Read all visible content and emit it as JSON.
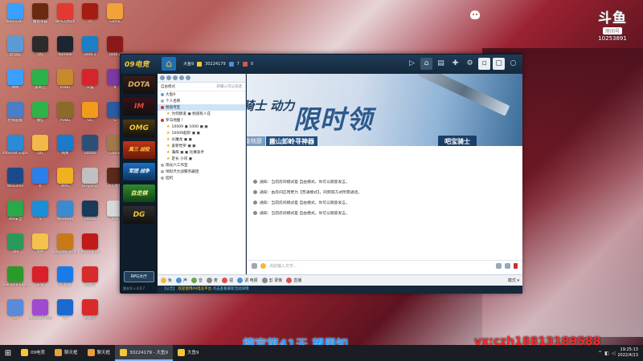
{
  "desktop": {
    "icons": [
      {
        "label": "Administ...",
        "color": "#3aa0ff",
        "col": 0,
        "row": 0
      },
      {
        "label": "魔兽争霸",
        "color": "#6a2a12",
        "col": 1,
        "row": 0
      },
      {
        "label": "WPS Office",
        "color": "#e23a32",
        "col": 2,
        "row": 0
      },
      {
        "label": "cf",
        "color": "#a41c12",
        "col": 3,
        "row": 0
      },
      {
        "label": "Game",
        "color": "#f2a23a",
        "col": 4,
        "row": 0
      },
      {
        "label": "此电脑",
        "color": "#5b9bd5",
        "col": 0,
        "row": 1
      },
      {
        "label": "QQ",
        "color": "#2b2b2b",
        "col": 1,
        "row": 1
      },
      {
        "label": "Rumble",
        "color": "#1a2530",
        "col": 2,
        "row": 1
      },
      {
        "label": "Dota 2",
        "color": "#1b7fc6",
        "col": 3,
        "row": 1
      },
      {
        "label": "Dota 2",
        "color": "#8a1a1a",
        "col": 4,
        "row": 1
      },
      {
        "label": "网络",
        "color": "#3aa0ff",
        "col": 0,
        "row": 2
      },
      {
        "label": "爱奇艺",
        "color": "#29b34a",
        "col": 1,
        "row": 2
      },
      {
        "label": "PUBG",
        "color": "#c78a2a",
        "col": 2,
        "row": 2
      },
      {
        "label": "天猫",
        "color": "#d6252a",
        "col": 3,
        "row": 2
      },
      {
        "label": "9",
        "color": "#7c3aa5",
        "col": 4,
        "row": 2
      },
      {
        "label": "控制面板",
        "color": "#4a7ec6",
        "col": 0,
        "row": 3
      },
      {
        "label": "微信",
        "color": "#2db34a",
        "col": 1,
        "row": 3
      },
      {
        "label": "PUBG",
        "color": "#8b6b2a",
        "col": 2,
        "row": 3
      },
      {
        "label": "GG",
        "color": "#f29a1a",
        "col": 3,
        "row": 3
      },
      {
        "label": "G",
        "color": "#2a5ba5",
        "col": 4,
        "row": 3
      },
      {
        "label": "Internet Explorer",
        "color": "#2a8bd8",
        "col": 0,
        "row": 4
      },
      {
        "label": "QQ",
        "color": "#f2b84a",
        "col": 1,
        "row": 4
      },
      {
        "label": "网易",
        "color": "#1a7acc",
        "col": 2,
        "row": 4
      },
      {
        "label": "Steam",
        "color": "#2a5078",
        "col": 3,
        "row": 4
      },
      {
        "label": "Game",
        "color": "#a27a4a",
        "col": 4,
        "row": 4
      },
      {
        "label": "WeGame",
        "color": "#1a4a8a",
        "col": 0,
        "row": 5
      },
      {
        "label": "K",
        "color": "#2b7fe8",
        "col": 1,
        "row": 5
      },
      {
        "label": "WPS",
        "color": "#f0b020",
        "col": 2,
        "row": 5
      },
      {
        "label": "Dropship",
        "color": "#c0c0c0",
        "col": 3,
        "row": 5
      },
      {
        "label": "人工智能",
        "color": "#5a2a1a",
        "col": 4,
        "row": 5
      },
      {
        "label": "360安全",
        "color": "#2aa84a",
        "col": 0,
        "row": 6
      },
      {
        "label": "S",
        "color": "#1a8fd8",
        "col": 1,
        "row": 6
      },
      {
        "label": "Windows",
        "color": "#3a8bd0",
        "col": 2,
        "row": 6
      },
      {
        "label": "Steam",
        "color": "#1a3a5a",
        "col": 3,
        "row": 6
      },
      {
        "label": "网易",
        "color": "#d8d8d8",
        "col": 4,
        "row": 6
      },
      {
        "label": "360",
        "color": "#2a9a5a",
        "col": 0,
        "row": 7
      },
      {
        "label": "文件",
        "color": "#f2c24a",
        "col": 1,
        "row": 7
      },
      {
        "label": "Counter-Strike",
        "color": "#c87a1a",
        "col": 2,
        "row": 7
      },
      {
        "label": "Among Us",
        "color": "#c21a1a",
        "col": 3,
        "row": 7
      },
      {
        "label": "GeForce Experience",
        "color": "#2a9a2a",
        "col": 0,
        "row": 8
      },
      {
        "label": "天猫",
        "color": "#d8202a",
        "col": 1,
        "row": 8
      },
      {
        "label": "PC管家",
        "color": "#1a7ae8",
        "col": 2,
        "row": 8
      },
      {
        "label": "网易云",
        "color": "#d82a2a",
        "col": 3,
        "row": 8
      },
      {
        "label": "Git",
        "color": "#5a8ad8",
        "col": 0,
        "row": 9
      },
      {
        "label": "Powered Party",
        "color": "#a04ad0",
        "col": 1,
        "row": 9
      },
      {
        "label": "PS",
        "color": "#1a6ad0",
        "col": 2,
        "row": 9
      },
      {
        "label": "网易云",
        "color": "#d82a2a",
        "col": 3,
        "row": 9
      }
    ]
  },
  "douyu": {
    "logo": "斗鱼",
    "room_label": "房间号",
    "room_number": "10253891"
  },
  "app": {
    "logo": "09电竞",
    "user_name": "大鱼9",
    "user_id": "30224179",
    "user_count": "7",
    "user_extra": "0",
    "top_tools": [
      {
        "name": "video-icon",
        "glyph": "▷",
        "active": false,
        "box": false
      },
      {
        "name": "home-tab-icon",
        "glyph": "⌂",
        "active": true,
        "box": false
      },
      {
        "name": "list-icon",
        "glyph": "▤",
        "active": false,
        "box": false
      },
      {
        "name": "gamepad-icon",
        "glyph": "✚",
        "active": false,
        "box": false
      },
      {
        "name": "settings-icon",
        "glyph": "⚙",
        "active": false,
        "box": false
      },
      {
        "name": "minimize-box-icon",
        "glyph": "▫",
        "active": false,
        "box": true
      },
      {
        "name": "window-box-icon",
        "glyph": "▢",
        "active": false,
        "box": true
      },
      {
        "name": "close-icon",
        "glyph": "○",
        "active": false,
        "box": false
      }
    ],
    "games": [
      {
        "label": "DOTA",
        "cls": "g-dota"
      },
      {
        "label": "IM",
        "cls": "g-im"
      },
      {
        "label": "OMG",
        "cls": "g-omg"
      },
      {
        "label": "真三 战役",
        "cls": "g-orange"
      },
      {
        "label": "军团 战争",
        "cls": "g-blue"
      },
      {
        "label": "自走棋",
        "cls": "g-green"
      },
      {
        "label": "DG",
        "cls": "g-dg"
      }
    ],
    "rpg_button": "RPG大厅",
    "version": "版本号 v 4.0.7",
    "channel": {
      "mode": "自由模式",
      "right_hint": "新输入可以说话",
      "rows": [
        {
          "text": "大鱼9",
          "level": 0,
          "sel": false,
          "icon": "dot",
          "color": "#5a9ed8"
        },
        {
          "text": "个人名称",
          "level": 0,
          "sel": false,
          "icon": "dot",
          "color": "#aaa"
        },
        {
          "text": "频道专区",
          "level": 0,
          "sel": true,
          "icon": "dot",
          "color": "#d2322a"
        },
        {
          "text": "为何频道 ▣ 频道有人在",
          "level": 1,
          "sel": false,
          "icon": "star",
          "color": "#222"
        },
        {
          "text": "罗马地图 !",
          "level": 0,
          "sel": false,
          "icon": "dot",
          "color": "#d2322a"
        },
        {
          "text": "10009 ▣ 1000 ▣ ▣",
          "level": 1,
          "sel": false,
          "icon": "star",
          "color": "#222"
        },
        {
          "text": "10009超轩 ▣ ▣",
          "level": 1,
          "sel": false,
          "icon": "star",
          "color": "#222"
        },
        {
          "text": "炎魔龙 ▣ ▣",
          "level": 1,
          "sel": false,
          "icon": "star",
          "color": "#222"
        },
        {
          "text": "爱新觉罗 ▣ ▣",
          "level": 1,
          "sel": false,
          "icon": "star",
          "color": "#222"
        },
        {
          "text": "满辉 ▣ ▣ 比赛高手",
          "level": 1,
          "sel": false,
          "icon": "star",
          "color": "#222"
        },
        {
          "text": "定长 小司 ▣",
          "level": 1,
          "sel": false,
          "icon": "star",
          "color": "#222"
        },
        {
          "text": "阳光六工作室",
          "level": 0,
          "sel": false,
          "icon": "dot",
          "color": "#aaa"
        },
        {
          "text": "地狱犬大战服务器团",
          "level": 0,
          "sel": false,
          "icon": "dot",
          "color": "#aaa"
        },
        {
          "text": "挂机",
          "level": 0,
          "sel": false,
          "icon": "dot",
          "color": "#aaa"
        }
      ]
    },
    "banner": {
      "left_text": "骑士 动力",
      "big_text": "限时领",
      "tag": "金枝厨",
      "sub": "搬山卸岭寻神器",
      "button": "吧宝骑士"
    },
    "messages": [
      "通知：当前房间模式是 自由模式，你可以随意发言。",
      "通知：由房间应用更为【普通模式】，同频等方式所需通话。",
      "通知：当前房间模式是 自由模式，你可以随意发言。",
      "通知：当前房间模式是 自由模式，你可以随意发言。"
    ],
    "input_placeholder": "点此输入文字...",
    "bottom": {
      "items": [
        "免",
        "声",
        "音",
        "麦",
        "视",
        "调 电报",
        "剪 录像",
        "直播"
      ],
      "right_label": "模式 ▾",
      "notice_prefix": "【公告】",
      "notice_highlight": "欢迎使用09电竞平台",
      "notice_rest": "点击查看最新活动详情"
    }
  },
  "taskbar": {
    "items": [
      {
        "label": "09电竞",
        "color": "#f6c635",
        "active": false
      },
      {
        "label": "聊天框",
        "color": "#e8a03a",
        "active": false
      },
      {
        "label": "聊天框",
        "color": "#e8a03a",
        "active": false
      },
      {
        "label": "30224179 - 大鱼9",
        "color": "#f6c635",
        "active": true
      },
      {
        "label": "大鱼9",
        "color": "#f6c635",
        "active": false
      }
    ],
    "overlay_blue": "德官第41天 望周知",
    "overlay_red": "vx:czh18813189588",
    "time": "19:25:13",
    "date": "2022/4/13"
  }
}
